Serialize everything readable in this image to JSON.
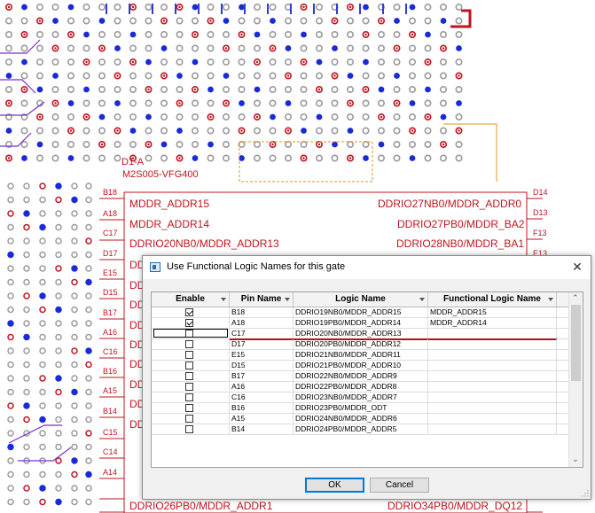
{
  "pcb": {
    "component_ref": "D1-A",
    "component_part": "M2S005-VFG400",
    "left_pins": [
      "B18",
      "A18",
      "C17",
      "D17",
      "E15",
      "D15",
      "B17",
      "A16",
      "C16",
      "B16",
      "A15",
      "B14",
      "C15",
      "C14",
      "A14"
    ],
    "right_pins": [
      "D14",
      "D13",
      "F13",
      "E13"
    ],
    "left_nets": [
      "MDDR_ADDR15",
      "MDDR_ADDR14",
      "DDRIO20NB0/MDDR_ADDR13"
    ],
    "right_nets": [
      "DDRIO27NB0/MDDR_ADDR0",
      "DDRIO27PB0/MDDR_BA2",
      "DDRIO28NB0/MDDR_BA1"
    ],
    "left_partial": [
      "DD",
      "DD",
      "DD",
      "DD",
      "DD",
      "DD",
      "DD",
      "DD",
      "DD"
    ],
    "bottom_left_net": "DDRIO26PB0/MDDR_ADDR1",
    "bottom_right_net": "DDRIO34PB0/MDDR_DQ12"
  },
  "dialog": {
    "title": "Use Functional Logic Names for this gate",
    "close_glyph": "✕",
    "columns": [
      "Enable",
      "Pin Name",
      "Logic Name",
      "Functional Logic Name"
    ],
    "rows": [
      {
        "enabled": true,
        "pin": "B18",
        "logic": "DDRIO19NB0/MDDR_ADDR15",
        "functional": "MDDR_ADDR15"
      },
      {
        "enabled": true,
        "pin": "A18",
        "logic": "DDRIO19PB0/MDDR_ADDR14",
        "functional": "MDDR_ADDR14"
      },
      {
        "enabled": false,
        "pin": "C17",
        "logic": "DDRIO20NB0/MDDR_ADDR13",
        "functional": ""
      },
      {
        "enabled": false,
        "pin": "D17",
        "logic": "DDRIO20PB0/MDDR_ADDR12",
        "functional": ""
      },
      {
        "enabled": false,
        "pin": "E15",
        "logic": "DDRIO21NB0/MDDR_ADDR11",
        "functional": ""
      },
      {
        "enabled": false,
        "pin": "D15",
        "logic": "DDRIO21PB0/MDDR_ADDR10",
        "functional": ""
      },
      {
        "enabled": false,
        "pin": "B17",
        "logic": "DDRIO22NB0/MDDR_ADDR9",
        "functional": ""
      },
      {
        "enabled": false,
        "pin": "A16",
        "logic": "DDRIO22PB0/MDDR_ADDR8",
        "functional": ""
      },
      {
        "enabled": false,
        "pin": "C16",
        "logic": "DDRIO23NB0/MDDR_ADDR7",
        "functional": ""
      },
      {
        "enabled": false,
        "pin": "B16",
        "logic": "DDRIO23PB0/MDDR_ODT",
        "functional": ""
      },
      {
        "enabled": false,
        "pin": "A15",
        "logic": "DDRIO24NB0/MDDR_ADDR6",
        "functional": ""
      },
      {
        "enabled": false,
        "pin": "B14",
        "logic": "DDRIO24PB0/MDDR_ADDR5",
        "functional": ""
      }
    ],
    "ok_label": "OK",
    "cancel_label": "Cancel"
  },
  "colors": {
    "pcb_red": "#c0141e",
    "via_blue": "#1a2ad8",
    "pad_grey": "#9a9a9a",
    "selection_red": "#b0141e",
    "default_button_border": "#0078d7"
  }
}
